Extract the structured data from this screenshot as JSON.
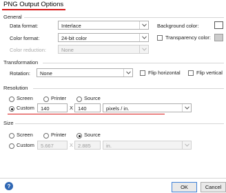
{
  "dialog": {
    "title": "PNG Output Options"
  },
  "general": {
    "group_label": "General",
    "data_format_label": "Data format:",
    "data_format_value": "Interlace",
    "color_format_label": "Color format:",
    "color_format_value": "24-bit color",
    "color_reduction_label": "Color reduction:",
    "color_reduction_value": "None",
    "background_color_label": "Background color:",
    "transparency_color_label": "Transparency color:"
  },
  "transformation": {
    "group_label": "Transformation",
    "rotation_label": "Rotation:",
    "rotation_value": "None",
    "flip_horizontal_label": "Flip horizontal",
    "flip_vertical_label": "Flip vertical"
  },
  "resolution": {
    "group_label": "Resolution",
    "screen_label": "Screen",
    "printer_label": "Printer",
    "source_label": "Source",
    "custom_label": "Custom",
    "width_value": "140",
    "times_label": "X",
    "height_value": "140",
    "unit_value": "pixels / in.",
    "selected": "Custom"
  },
  "size": {
    "group_label": "Size",
    "screen_label": "Screen",
    "printer_label": "Printer",
    "source_label": "Source",
    "custom_label": "Custom",
    "width_value": "5.667",
    "times_label": "X",
    "height_value": "2.885",
    "unit_value": "in.",
    "selected": "Source"
  },
  "footer": {
    "help_glyph": "?",
    "ok_label": "OK",
    "cancel_label": "Cancel"
  },
  "colors": {
    "annotation_red": "#d71313",
    "help_blue": "#2f67b4"
  }
}
